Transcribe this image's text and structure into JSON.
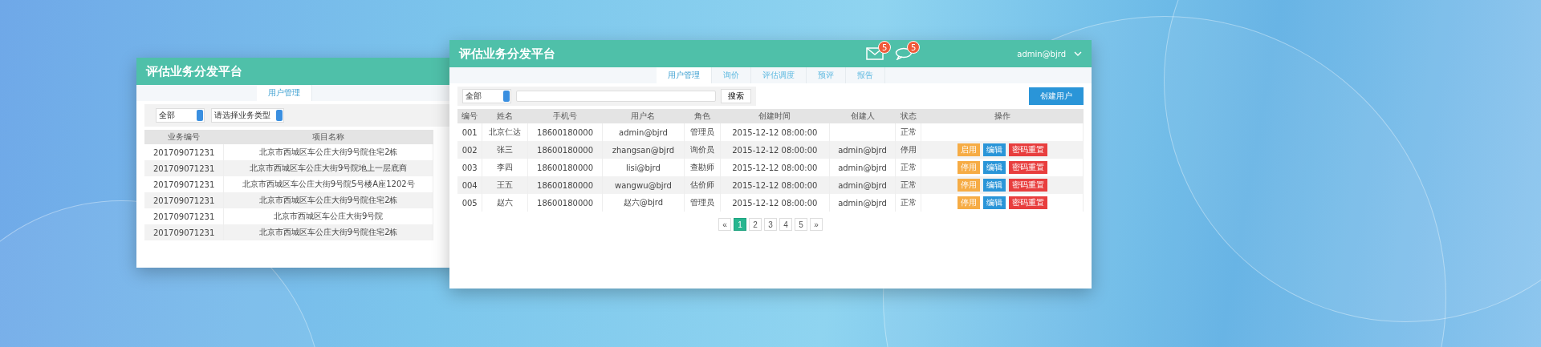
{
  "back_window": {
    "title": "评估业务分发平台",
    "tabs": [
      {
        "label": "用户管理",
        "selected": true
      }
    ],
    "filters": [
      "全部",
      "请选择业务类型"
    ],
    "table": {
      "columns": [
        "业务编号",
        "项目名称"
      ],
      "rows": [
        [
          "201709071231",
          "北京市西城区车公庄大街9号院住宅2栋"
        ],
        [
          "201709071231",
          "北京市西城区车公庄大街9号院地上一层底商"
        ],
        [
          "201709071231",
          "北京市西城区车公庄大街9号院5号楼A座1202号"
        ],
        [
          "201709071231",
          "北京市西城区车公庄大街9号院住宅2栋"
        ],
        [
          "201709071231",
          "北京市西城区车公庄大街9号院"
        ],
        [
          "201709071231",
          "北京市西城区车公庄大街9号院住宅2栋"
        ]
      ]
    }
  },
  "window": {
    "title": "评估业务分发平台",
    "notifications": [
      {
        "kind": "mail",
        "count": "5"
      },
      {
        "kind": "chat",
        "count": "5"
      }
    ],
    "user": "admin@bjrd"
  },
  "tabs": [
    {
      "label": "用户管理",
      "selected": true
    },
    {
      "label": "询价",
      "selected": false
    },
    {
      "label": "评估调度",
      "selected": false
    },
    {
      "label": "预评",
      "selected": false
    },
    {
      "label": "报告",
      "selected": false
    }
  ],
  "toolbar": {
    "filter": "全部",
    "search_button": "搜索",
    "create_button": "创建用户"
  },
  "table": {
    "columns": [
      "编号",
      "姓名",
      "手机号",
      "用户名",
      "角色",
      "创建时间",
      "创建人",
      "状态",
      "操作"
    ],
    "rows": [
      {
        "cells": [
          "001",
          "北京仁达",
          "18600180000",
          "admin@bjrd",
          "管理员",
          "2015-12-12 08:00:00",
          "",
          "正常"
        ],
        "actions": []
      },
      {
        "cells": [
          "002",
          "张三",
          "18600180000",
          "zhangsan@bjrd",
          "询价员",
          "2015-12-12 08:00:00",
          "admin@bjrd",
          "停用"
        ],
        "actions": [
          {
            "kind": "toggle",
            "label": "启用"
          },
          {
            "kind": "edit",
            "label": "编辑"
          },
          {
            "kind": "reset",
            "label": "密码重置"
          }
        ]
      },
      {
        "cells": [
          "003",
          "李四",
          "18600180000",
          "lisi@bjrd",
          "查勘师",
          "2015-12-12 08:00:00",
          "admin@bjrd",
          "正常"
        ],
        "actions": [
          {
            "kind": "toggle",
            "label": "停用"
          },
          {
            "kind": "edit",
            "label": "编辑"
          },
          {
            "kind": "reset",
            "label": "密码重置"
          }
        ]
      },
      {
        "cells": [
          "004",
          "王五",
          "18600180000",
          "wangwu@bjrd",
          "估价师",
          "2015-12-12 08:00:00",
          "admin@bjrd",
          "正常"
        ],
        "actions": [
          {
            "kind": "toggle",
            "label": "停用"
          },
          {
            "kind": "edit",
            "label": "编辑"
          },
          {
            "kind": "reset",
            "label": "密码重置"
          }
        ]
      },
      {
        "cells": [
          "005",
          "赵六",
          "18600180000",
          "赵六@bjrd",
          "管理员",
          "2015-12-12 08:00:00",
          "admin@bjrd",
          "正常"
        ],
        "actions": [
          {
            "kind": "toggle",
            "label": "停用"
          },
          {
            "kind": "edit",
            "label": "编辑"
          },
          {
            "kind": "reset",
            "label": "密码重置"
          }
        ]
      }
    ]
  },
  "pagination": {
    "prev": "«",
    "next": "»",
    "pages": [
      {
        "label": "1",
        "selected": true
      },
      {
        "label": "2",
        "selected": false
      },
      {
        "label": "3",
        "selected": false
      },
      {
        "label": "4",
        "selected": false
      },
      {
        "label": "5",
        "selected": false
      }
    ]
  }
}
